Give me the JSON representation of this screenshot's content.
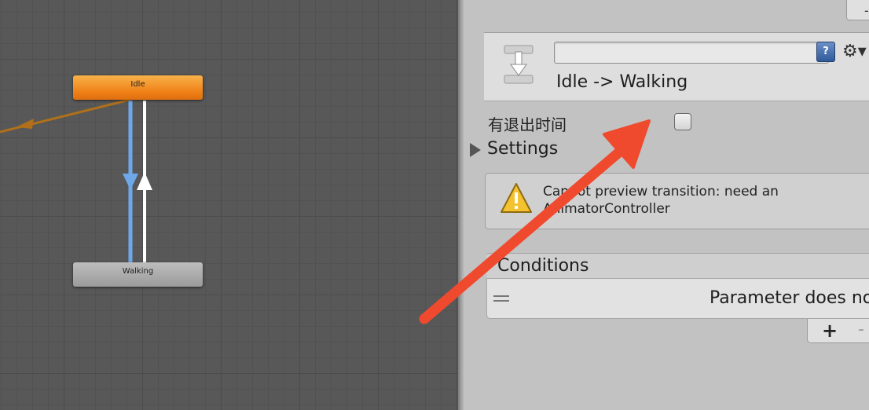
{
  "graph": {
    "states": {
      "idle": "Idle",
      "walking": "Walking"
    },
    "colors": {
      "idle_state": "#ee7f15",
      "default_transition": "#b0701a",
      "selected_transition": "#6fa8e8",
      "transition": "#ffffff"
    }
  },
  "inspector": {
    "top_tab_label": "-",
    "header": {
      "name_value": "",
      "help_icon_label": "?",
      "gear_icon": "⚙▾",
      "title": "Idle -> Walking"
    },
    "has_exit_time": {
      "label": "有退出时间",
      "checked": false
    },
    "settings": {
      "label": "Settings",
      "expanded": false
    },
    "warning": {
      "icon": "warning-icon",
      "text": "Cannot preview transition: need an AnimatorController"
    },
    "conditions": {
      "label": "Conditions",
      "row_text": "Parameter does no",
      "add_label": "+",
      "remove_label": "-"
    }
  },
  "annotation": {
    "color": "#f04a2e"
  }
}
